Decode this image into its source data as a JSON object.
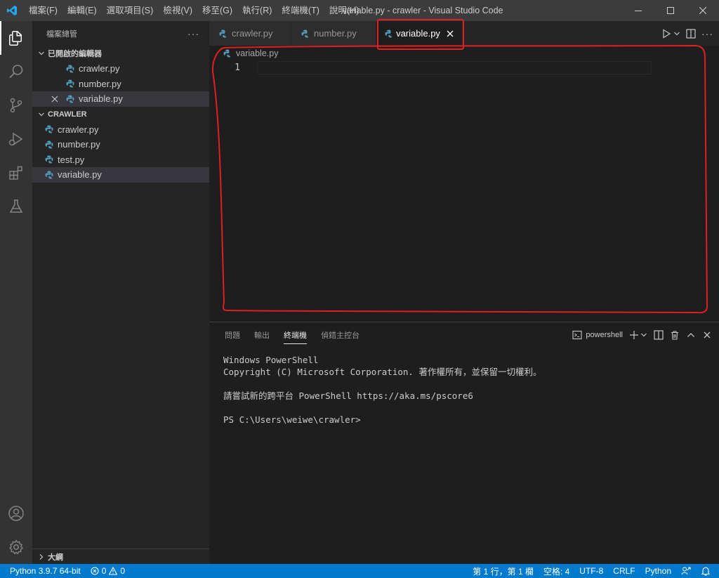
{
  "titlebar": {
    "menu": [
      "檔案(F)",
      "編輯(E)",
      "選取項目(S)",
      "檢視(V)",
      "移至(G)",
      "執行(R)",
      "終端機(T)",
      "說明(H)"
    ],
    "window_title": "variable.py - crawler - Visual Studio Code"
  },
  "activitybar": {
    "icons": [
      "explorer-icon",
      "search-icon",
      "source-control-icon",
      "run-debug-icon",
      "extensions-icon",
      "testing-icon"
    ],
    "bottom_icons": [
      "account-icon",
      "settings-gear-icon"
    ]
  },
  "sidebar": {
    "title": "檔案總管",
    "more": "···",
    "open_editors": {
      "label": "已開啟的編輯器",
      "items": [
        "crawler.py",
        "number.py",
        "variable.py"
      ]
    },
    "folder": {
      "label": "CRAWLER",
      "items": [
        "crawler.py",
        "number.py",
        "test.py",
        "variable.py"
      ]
    },
    "outline": "大綱"
  },
  "editor": {
    "tabs": [
      {
        "label": "crawler.py"
      },
      {
        "label": "number.py"
      },
      {
        "label": "variable.py"
      }
    ],
    "breadcrumb": "variable.py",
    "line_number": "1"
  },
  "panel": {
    "tabs": [
      "問題",
      "輸出",
      "終端機",
      "偵錯主控台"
    ],
    "terminal_name": "powershell",
    "terminal_lines": [
      "Windows PowerShell",
      "Copyright (C) Microsoft Corporation. 著作權所有，並保留一切權利。",
      "",
      "請嘗試新的跨平台 PowerShell https://aka.ms/pscore6",
      "",
      "PS C:\\Users\\weiwe\\crawler>"
    ]
  },
  "statusbar": {
    "interpreter": "Python 3.9.7 64-bit",
    "errors": "0",
    "warnings": "0",
    "position": "第 1 行，第 1 欄",
    "spaces": "空格: 4",
    "encoding": "UTF-8",
    "eol": "CRLF",
    "language": "Python"
  },
  "colors": {
    "accent": "#007acc",
    "annotation": "#e02020",
    "python_icon": "#519aba"
  }
}
